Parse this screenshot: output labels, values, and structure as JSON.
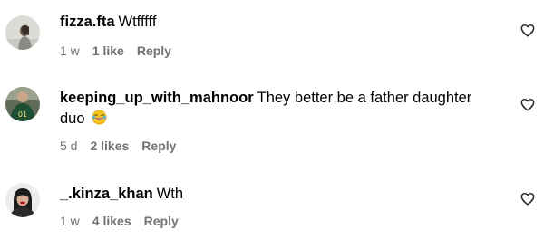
{
  "comments": [
    {
      "username": "fizza.fta",
      "text": "Wtfffff",
      "emoji": "",
      "time": "1 w",
      "likes": "1 like",
      "reply": "Reply",
      "avatar": "avatar-fizza"
    },
    {
      "username": "keeping_up_with_mahnoor",
      "text": "They better be a father daughter duo",
      "emoji": "laughing-face-emoji",
      "time": "5 d",
      "likes": "2 likes",
      "reply": "Reply",
      "avatar": "avatar-mahnoor",
      "avatar_jersey": "01"
    },
    {
      "username": "_.kinza_khan",
      "text": "Wth",
      "emoji": "",
      "time": "1 w",
      "likes": "4 likes",
      "reply": "Reply",
      "avatar": "avatar-kinza"
    }
  ],
  "icons": {
    "like": "heart-outline-icon"
  },
  "colors": {
    "meta_text": "#737373",
    "primary_text": "#000000",
    "background": "#ffffff"
  }
}
